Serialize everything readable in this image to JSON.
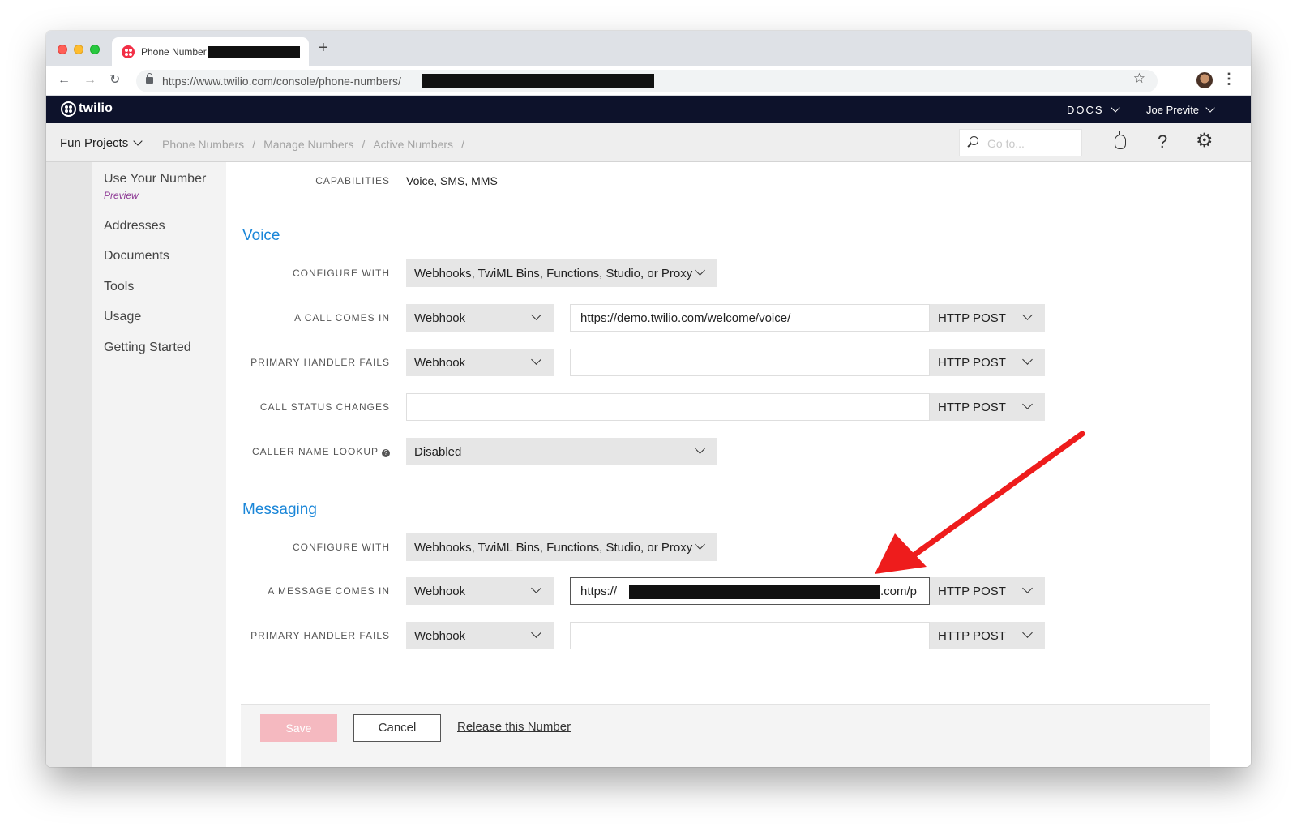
{
  "browser": {
    "tab_title": "Phone Number",
    "new_tab": "+",
    "url": "https://www.twilio.com/console/phone-numbers/"
  },
  "navbar": {
    "logo": "twilio",
    "docs": "DOCS",
    "user": "Joe Previte"
  },
  "subnav": {
    "project": "Fun Projects",
    "breadcrumbs": [
      "Phone Numbers",
      "Manage Numbers",
      "Active Numbers"
    ],
    "separator": "/",
    "search_placeholder": "Go to..."
  },
  "sidebar": {
    "items": [
      {
        "label": "Use Your Number",
        "badge": "Preview"
      },
      {
        "label": "Addresses"
      },
      {
        "label": "Documents"
      },
      {
        "label": "Tools"
      },
      {
        "label": "Usage"
      },
      {
        "label": "Getting Started"
      }
    ]
  },
  "capabilities": {
    "label": "CAPABILITIES",
    "value": "Voice, SMS, MMS"
  },
  "voice": {
    "title": "Voice",
    "configure_label": "CONFIGURE WITH",
    "configure_value": "Webhooks, TwiML Bins, Functions, Studio, or Proxy",
    "call_comes_in_label": "A CALL COMES IN",
    "call_comes_in_type": "Webhook",
    "call_comes_in_url": "https://demo.twilio.com/welcome/voice/",
    "call_comes_in_method": "HTTP POST",
    "primary_fails_label": "PRIMARY HANDLER FAILS",
    "primary_fails_type": "Webhook",
    "primary_fails_url": "",
    "primary_fails_method": "HTTP POST",
    "status_label": "CALL STATUS CHANGES",
    "status_url": "",
    "status_method": "HTTP POST",
    "caller_lookup_label": "CALLER NAME LOOKUP",
    "caller_lookup_value": "Disabled"
  },
  "messaging": {
    "title": "Messaging",
    "configure_label": "CONFIGURE WITH",
    "configure_value": "Webhooks, TwiML Bins, Functions, Studio, or Proxy",
    "message_comes_in_label": "A MESSAGE COMES IN",
    "message_comes_in_type": "Webhook",
    "message_comes_in_url_prefix": "https://",
    "message_comes_in_url_suffix": ".com/p",
    "message_comes_in_method": "HTTP POST",
    "primary_fails_label": "PRIMARY HANDLER FAILS",
    "primary_fails_type": "Webhook",
    "primary_fails_url": "",
    "primary_fails_method": "HTTP POST"
  },
  "actions": {
    "save": "Save",
    "cancel": "Cancel",
    "release": "Release this Number"
  },
  "colors": {
    "navbar_bg": "#0d122b",
    "section_title": "#1a86d8",
    "save_disabled": "#f5b9c0",
    "preview_badge": "#8e3a95",
    "annotation_arrow": "#ee1c1c"
  }
}
